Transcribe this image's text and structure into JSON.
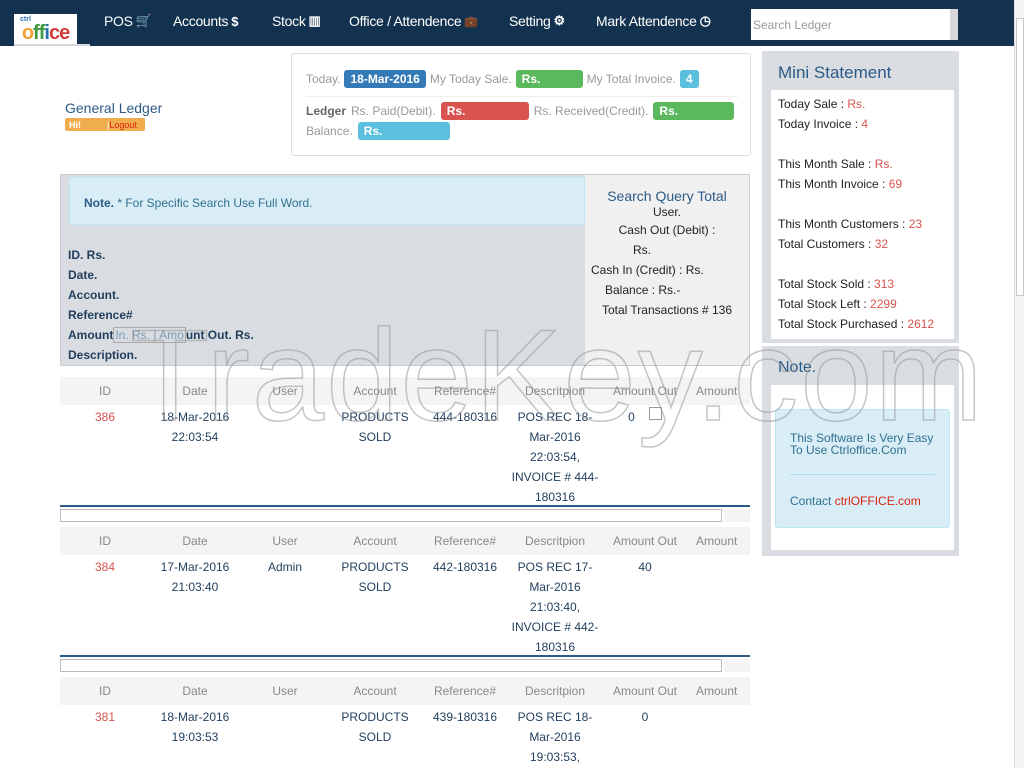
{
  "navbar": {
    "logo_top": "ctrl",
    "logo_letters": [
      "o",
      "f",
      "f",
      "i",
      "c",
      "e"
    ],
    "items": [
      {
        "label": "POS",
        "icon": "🛒"
      },
      {
        "label": "Accounts",
        "icon": "$"
      },
      {
        "label": "Stock",
        "icon": "▥"
      },
      {
        "label": "Office / Attendence",
        "icon": "💼"
      },
      {
        "label": "Setting",
        "icon": "⚙"
      },
      {
        "label": "Mark Attendence",
        "icon": "◷"
      }
    ],
    "search_placeholder": "Search Ledger"
  },
  "header": {
    "title": "General Ledger",
    "greeting": "Hi!",
    "separator": "|",
    "logout": "Logout"
  },
  "summary": {
    "today_label": "Today.",
    "today_value": "18-Mar-2016",
    "today_sale_label": "My Today Sale.",
    "today_sale_value": "Rs.",
    "total_invoice_label": "My Total Invoice.",
    "total_invoice_value": "4",
    "ledger_label": "Ledger",
    "paid_label": "Rs. Paid(Debit).",
    "paid_value": "Rs.",
    "received_label": "Rs. Received(Credit).",
    "received_value": "Rs.",
    "balance_label": "Balance.",
    "balance_value": "Rs."
  },
  "search_panel": {
    "note_bold": "Note.",
    "note_text": " * For Specific Search Use Full Word.",
    "fields": [
      "ID. Rs.",
      "Date.",
      "Account.",
      "Reference#"
    ],
    "amount_prefix": "Amount",
    "amount_in": "In. Rs. | Amo",
    "amount_suffix": "unt Out. Rs.",
    "description": "Description.",
    "query_total": {
      "title": "Search Query Total",
      "user": "User.",
      "cash_out": "Cash Out (Debit) :",
      "cash_out_value": "Rs.",
      "cash_in": "Cash In (Credit) : Rs.",
      "balance": "Balance : Rs.-",
      "transactions": "Total Transactions # 136"
    }
  },
  "table": {
    "columns": [
      "ID",
      "Date",
      "User",
      "Account",
      "Reference#",
      "Descritpion",
      "Amount Out",
      "Amount"
    ],
    "rows": [
      {
        "id": "386",
        "date": [
          "18-Mar-2016",
          "22:03:54"
        ],
        "user": "",
        "account": [
          "PRODUCTS",
          "SOLD"
        ],
        "reference": "444-180316",
        "description": [
          "POS REC 18-",
          "Mar-2016",
          "22:03:54,",
          "INVOICE # 444-",
          "180316"
        ],
        "amount_out": "0",
        "amount_in": ""
      },
      {
        "id": "384",
        "date": [
          "17-Mar-2016",
          "21:03:40"
        ],
        "user": "Admin",
        "account": [
          "PRODUCTS",
          "SOLD"
        ],
        "reference": "442-180316",
        "description": [
          "POS REC 17-",
          "Mar-2016",
          "21:03:40,",
          "INVOICE # 442-",
          "180316"
        ],
        "amount_out": "40",
        "amount_in": ""
      },
      {
        "id": "381",
        "date": [
          "18-Mar-2016",
          "19:03:53"
        ],
        "user": "",
        "account": [
          "PRODUCTS",
          "SOLD"
        ],
        "reference": "439-180316",
        "description": [
          "POS REC 18-",
          "Mar-2016",
          "19:03:53,"
        ],
        "amount_out": "0",
        "amount_in": ""
      }
    ]
  },
  "mini_statement": {
    "title": "Mini Statement",
    "groups": [
      [
        {
          "label": "Today Sale : ",
          "value": "Rs."
        },
        {
          "label": "Today Invoice : ",
          "value": " 4"
        }
      ],
      [
        {
          "label": "This Month Sale : ",
          "value": "Rs."
        },
        {
          "label": "This Month Invoice : ",
          "value": "69"
        }
      ],
      [
        {
          "label": "This Month Customers : ",
          "value": "23"
        },
        {
          "label": "Total Customers : ",
          "value": "32"
        }
      ],
      [
        {
          "label": "Total Stock Sold : ",
          "value": "313"
        },
        {
          "label": "Total Stock Left : ",
          "value": "2299"
        },
        {
          "label": "Total Stock Purchased : ",
          "value": "2612"
        }
      ]
    ]
  },
  "note_panel": {
    "title": "Note.",
    "text": "This Software Is Very Easy To Use Ctrloffice.Com",
    "contact_label": "Contact ",
    "contact_link": "ctrlOFFICE.com"
  },
  "watermark": "TradeKey.com"
}
